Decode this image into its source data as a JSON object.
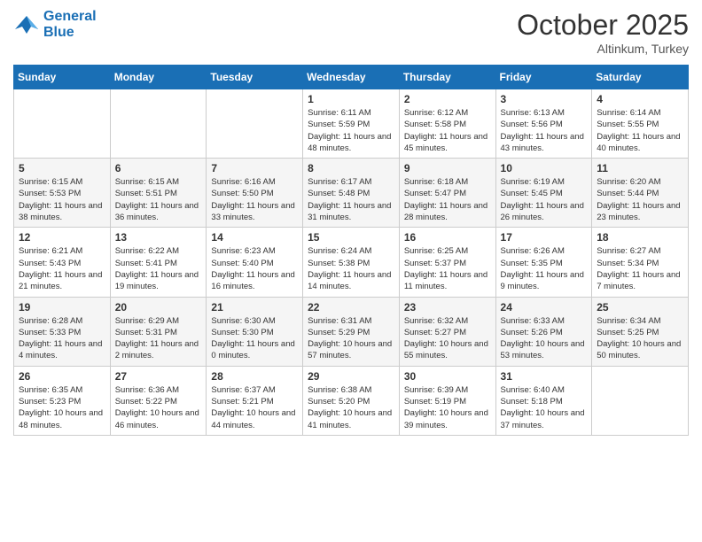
{
  "header": {
    "logo_line1": "General",
    "logo_line2": "Blue",
    "month_title": "October 2025",
    "subtitle": "Altinkum, Turkey"
  },
  "weekdays": [
    "Sunday",
    "Monday",
    "Tuesday",
    "Wednesday",
    "Thursday",
    "Friday",
    "Saturday"
  ],
  "weeks": [
    [
      {
        "day": "",
        "info": ""
      },
      {
        "day": "",
        "info": ""
      },
      {
        "day": "",
        "info": ""
      },
      {
        "day": "1",
        "info": "Sunrise: 6:11 AM\nSunset: 5:59 PM\nDaylight: 11 hours and 48 minutes."
      },
      {
        "day": "2",
        "info": "Sunrise: 6:12 AM\nSunset: 5:58 PM\nDaylight: 11 hours and 45 minutes."
      },
      {
        "day": "3",
        "info": "Sunrise: 6:13 AM\nSunset: 5:56 PM\nDaylight: 11 hours and 43 minutes."
      },
      {
        "day": "4",
        "info": "Sunrise: 6:14 AM\nSunset: 5:55 PM\nDaylight: 11 hours and 40 minutes."
      }
    ],
    [
      {
        "day": "5",
        "info": "Sunrise: 6:15 AM\nSunset: 5:53 PM\nDaylight: 11 hours and 38 minutes."
      },
      {
        "day": "6",
        "info": "Sunrise: 6:15 AM\nSunset: 5:51 PM\nDaylight: 11 hours and 36 minutes."
      },
      {
        "day": "7",
        "info": "Sunrise: 6:16 AM\nSunset: 5:50 PM\nDaylight: 11 hours and 33 minutes."
      },
      {
        "day": "8",
        "info": "Sunrise: 6:17 AM\nSunset: 5:48 PM\nDaylight: 11 hours and 31 minutes."
      },
      {
        "day": "9",
        "info": "Sunrise: 6:18 AM\nSunset: 5:47 PM\nDaylight: 11 hours and 28 minutes."
      },
      {
        "day": "10",
        "info": "Sunrise: 6:19 AM\nSunset: 5:45 PM\nDaylight: 11 hours and 26 minutes."
      },
      {
        "day": "11",
        "info": "Sunrise: 6:20 AM\nSunset: 5:44 PM\nDaylight: 11 hours and 23 minutes."
      }
    ],
    [
      {
        "day": "12",
        "info": "Sunrise: 6:21 AM\nSunset: 5:43 PM\nDaylight: 11 hours and 21 minutes."
      },
      {
        "day": "13",
        "info": "Sunrise: 6:22 AM\nSunset: 5:41 PM\nDaylight: 11 hours and 19 minutes."
      },
      {
        "day": "14",
        "info": "Sunrise: 6:23 AM\nSunset: 5:40 PM\nDaylight: 11 hours and 16 minutes."
      },
      {
        "day": "15",
        "info": "Sunrise: 6:24 AM\nSunset: 5:38 PM\nDaylight: 11 hours and 14 minutes."
      },
      {
        "day": "16",
        "info": "Sunrise: 6:25 AM\nSunset: 5:37 PM\nDaylight: 11 hours and 11 minutes."
      },
      {
        "day": "17",
        "info": "Sunrise: 6:26 AM\nSunset: 5:35 PM\nDaylight: 11 hours and 9 minutes."
      },
      {
        "day": "18",
        "info": "Sunrise: 6:27 AM\nSunset: 5:34 PM\nDaylight: 11 hours and 7 minutes."
      }
    ],
    [
      {
        "day": "19",
        "info": "Sunrise: 6:28 AM\nSunset: 5:33 PM\nDaylight: 11 hours and 4 minutes."
      },
      {
        "day": "20",
        "info": "Sunrise: 6:29 AM\nSunset: 5:31 PM\nDaylight: 11 hours and 2 minutes."
      },
      {
        "day": "21",
        "info": "Sunrise: 6:30 AM\nSunset: 5:30 PM\nDaylight: 11 hours and 0 minutes."
      },
      {
        "day": "22",
        "info": "Sunrise: 6:31 AM\nSunset: 5:29 PM\nDaylight: 10 hours and 57 minutes."
      },
      {
        "day": "23",
        "info": "Sunrise: 6:32 AM\nSunset: 5:27 PM\nDaylight: 10 hours and 55 minutes."
      },
      {
        "day": "24",
        "info": "Sunrise: 6:33 AM\nSunset: 5:26 PM\nDaylight: 10 hours and 53 minutes."
      },
      {
        "day": "25",
        "info": "Sunrise: 6:34 AM\nSunset: 5:25 PM\nDaylight: 10 hours and 50 minutes."
      }
    ],
    [
      {
        "day": "26",
        "info": "Sunrise: 6:35 AM\nSunset: 5:23 PM\nDaylight: 10 hours and 48 minutes."
      },
      {
        "day": "27",
        "info": "Sunrise: 6:36 AM\nSunset: 5:22 PM\nDaylight: 10 hours and 46 minutes."
      },
      {
        "day": "28",
        "info": "Sunrise: 6:37 AM\nSunset: 5:21 PM\nDaylight: 10 hours and 44 minutes."
      },
      {
        "day": "29",
        "info": "Sunrise: 6:38 AM\nSunset: 5:20 PM\nDaylight: 10 hours and 41 minutes."
      },
      {
        "day": "30",
        "info": "Sunrise: 6:39 AM\nSunset: 5:19 PM\nDaylight: 10 hours and 39 minutes."
      },
      {
        "day": "31",
        "info": "Sunrise: 6:40 AM\nSunset: 5:18 PM\nDaylight: 10 hours and 37 minutes."
      },
      {
        "day": "",
        "info": ""
      }
    ]
  ]
}
